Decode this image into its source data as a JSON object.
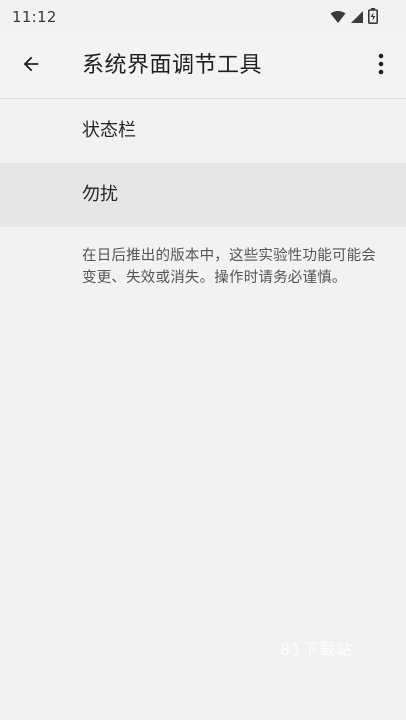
{
  "status_bar": {
    "time": "11:12",
    "icons": [
      "wifi-icon",
      "signal-icon",
      "battery-icon"
    ]
  },
  "app_bar": {
    "title": "系统界面调节工具",
    "back_icon": "arrow-left-icon",
    "overflow_icon": "more-vert-icon"
  },
  "list": {
    "items": [
      {
        "label": "状态栏"
      },
      {
        "label": "勿扰"
      }
    ]
  },
  "note": "在日后推出的版本中，这些实验性功能可能会变更、失效或消失。操作时请务必谨慎。",
  "watermark": "81下载站",
  "colors": {
    "background": "#f2f2f2",
    "highlight": "#e6e6e6",
    "text_primary": "#202020",
    "text_secondary": "#555555"
  }
}
